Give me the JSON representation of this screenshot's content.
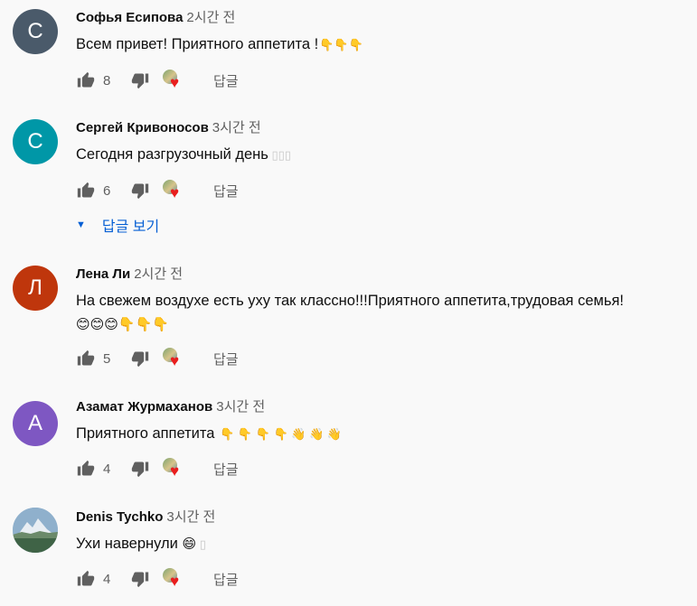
{
  "colors": {
    "background": "#f9f9f9",
    "link": "#065fd4",
    "heart": "#e91e1e",
    "secondary_text": "#606060"
  },
  "reply_label": "답글",
  "view_replies_label": "답글 보기",
  "comments": [
    {
      "avatar_letter": "С",
      "avatar_color": "#4a5a6a",
      "author": "Софья Есипова",
      "time": "2시간 전",
      "text": "Всем привет! Приятного аппетита !",
      "emoji": "👇👇👇",
      "likes": "8"
    },
    {
      "avatar_letter": "С",
      "avatar_color": "#0097a7",
      "author": "Сергей Кривоносов",
      "time": "3시간 전",
      "text": "Сегодня разгрузочный день",
      "emoji": "",
      "likes": "6"
    },
    {
      "avatar_letter": "Л",
      "avatar_color": "#bf360c",
      "author": "Лена Ли",
      "time": "2시간 전",
      "text": "На свежем воздухе есть уху так классно!!!Приятного аппетита,трудовая семья!",
      "emoji": "😊😊😊👇👇👇",
      "likes": "5"
    },
    {
      "avatar_letter": "А",
      "avatar_color": "#7e57c2",
      "author": "Азамат Журмаханов",
      "time": "3시간 전",
      "text": "Приятного аппетита",
      "emoji": "👇 👇 👇 👇 👋 👋 👋",
      "likes": "4"
    },
    {
      "avatar_letter": "",
      "avatar_color": "#8fb0cc",
      "author": "Denis Tychko",
      "time": "3시간 전",
      "text": "Ухи навернули",
      "emoji": "😄",
      "likes": "4"
    }
  ]
}
